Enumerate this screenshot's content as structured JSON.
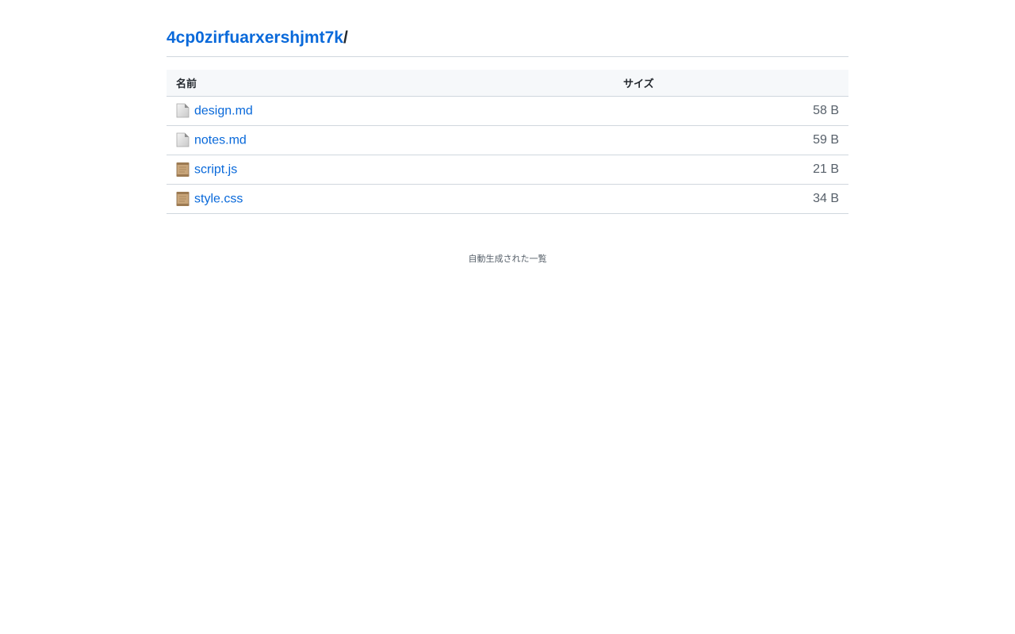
{
  "header": {
    "directory_link": "4cp0zirfuarxershjmt7k",
    "separator": "/"
  },
  "table": {
    "columns": {
      "name": "名前",
      "size": "サイズ"
    },
    "rows": [
      {
        "name": "design.md",
        "size": "58 B",
        "icon": "document-icon"
      },
      {
        "name": "notes.md",
        "size": "59 B",
        "icon": "document-icon"
      },
      {
        "name": "script.js",
        "size": "21 B",
        "icon": "script-icon"
      },
      {
        "name": "style.css",
        "size": "34 B",
        "icon": "script-icon"
      }
    ]
  },
  "footer": {
    "text": "自動生成された一覧"
  },
  "colors": {
    "link": "#0969da",
    "header_bg": "#f6f8fa",
    "border": "#d0d7de"
  }
}
